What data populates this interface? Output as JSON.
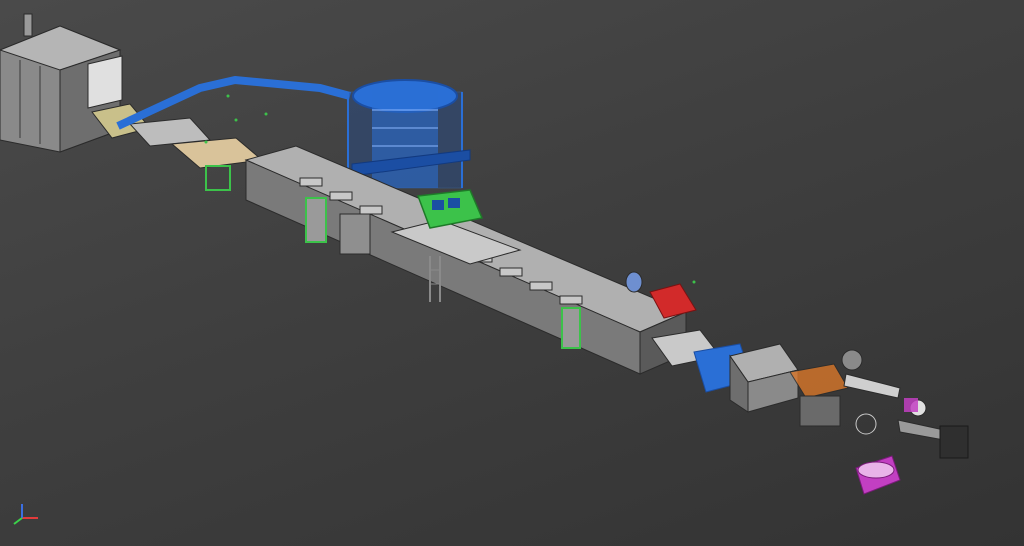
{
  "viewport": {
    "background_top": "#4a4a4a",
    "background_bottom": "#333333"
  },
  "colors": {
    "body_grey": "#7a7a7a",
    "body_light": "#a9a9a9",
    "body_dark": "#5a5a5a",
    "edge": "#2b2b2b",
    "blue": "#2a6fd6",
    "blue_dark": "#1b4ea3",
    "green": "#3cc24a",
    "red": "#d22a2a",
    "tan": "#d9c39a",
    "magenta": "#c23fc2",
    "orange": "#d9772a"
  },
  "triad": {
    "x_axis_color": "#e23b3b",
    "y_axis_color": "#3bd24a",
    "z_axis_color": "#3b6fe2",
    "icon": "coordinate-triad-icon"
  }
}
